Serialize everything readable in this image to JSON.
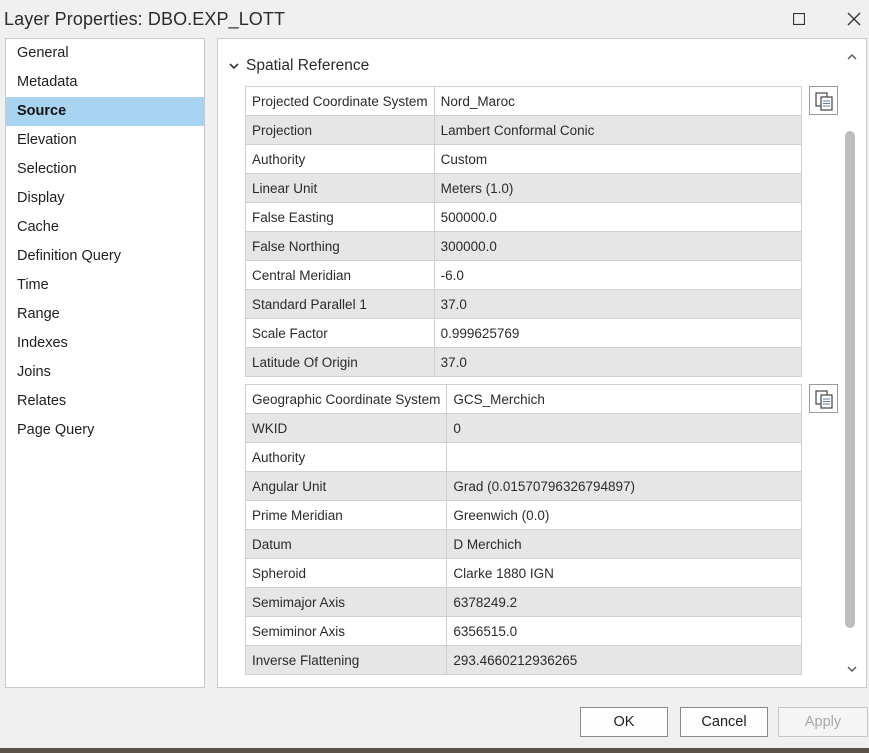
{
  "window": {
    "title": "Layer Properties: DBO.EXP_LOTT",
    "maximize_icon": "maximize-icon",
    "close_icon": "close-icon"
  },
  "sidebar": {
    "items": [
      {
        "label": "General"
      },
      {
        "label": "Metadata"
      },
      {
        "label": "Source",
        "active": true
      },
      {
        "label": "Elevation"
      },
      {
        "label": "Selection"
      },
      {
        "label": "Display"
      },
      {
        "label": "Cache"
      },
      {
        "label": "Definition Query"
      },
      {
        "label": "Time"
      },
      {
        "label": "Range"
      },
      {
        "label": "Indexes"
      },
      {
        "label": "Joins"
      },
      {
        "label": "Relates"
      },
      {
        "label": "Page Query"
      }
    ]
  },
  "section": {
    "title": "Spatial Reference"
  },
  "projected": {
    "rows": [
      {
        "key": "Projected Coordinate System",
        "value": "Nord_Maroc"
      },
      {
        "key": "Projection",
        "value": "Lambert Conformal Conic"
      },
      {
        "key": "Authority",
        "value": "Custom"
      },
      {
        "key": "Linear Unit",
        "value": "Meters (1.0)"
      },
      {
        "key": "False Easting",
        "value": "500000.0"
      },
      {
        "key": "False Northing",
        "value": "300000.0"
      },
      {
        "key": "Central Meridian",
        "value": "-6.0"
      },
      {
        "key": "Standard Parallel 1",
        "value": "37.0"
      },
      {
        "key": "Scale Factor",
        "value": "0.999625769"
      },
      {
        "key": "Latitude Of Origin",
        "value": "37.0"
      }
    ]
  },
  "geographic": {
    "rows": [
      {
        "key": "Geographic Coordinate System",
        "value": "GCS_Merchich"
      },
      {
        "key": "WKID",
        "value": "0"
      },
      {
        "key": "Authority",
        "value": ""
      },
      {
        "key": "Angular Unit",
        "value": "Grad (0.01570796326794897)"
      },
      {
        "key": "Prime Meridian",
        "value": "Greenwich (0.0)"
      },
      {
        "key": "Datum",
        "value": "D Merchich"
      },
      {
        "key": "Spheroid",
        "value": "Clarke 1880 IGN"
      },
      {
        "key": "Semimajor Axis",
        "value": "6378249.2"
      },
      {
        "key": "Semiminor Axis",
        "value": "6356515.0"
      },
      {
        "key": "Inverse Flattening",
        "value": "293.4660212936265"
      }
    ]
  },
  "footer": {
    "ok_label": "OK",
    "cancel_label": "Cancel",
    "apply_label": "Apply",
    "apply_enabled": false
  },
  "colors": {
    "selected_item": "#a8d4f2",
    "alt_row": "#e6e6e6"
  }
}
